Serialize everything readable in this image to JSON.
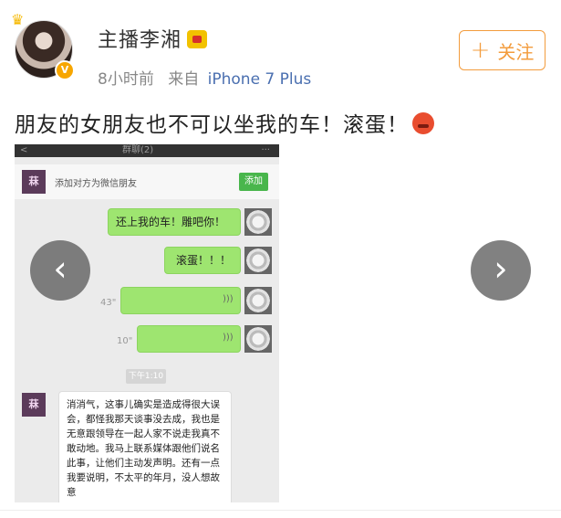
{
  "author": {
    "name": "主播李湘",
    "time": "8小时前",
    "source_prefix": "来自",
    "source": "iPhone 7 Plus"
  },
  "follow_button": {
    "label": "关注",
    "color": "#f39c3d"
  },
  "post": {
    "text": "朋友的女朋友也不可以坐我的车！滚蛋！"
  },
  "screenshot": {
    "back_label": "<",
    "chat_title": "群聊(2)",
    "menu_icon": "···",
    "add_bar_text": "添加对方为微信朋友",
    "add_button": "添加",
    "avatar_char": "菻",
    "messages_out": [
      {
        "text": "还上我的车！雕吧你！"
      },
      {
        "text": "滚蛋！！！"
      }
    ],
    "voice_messages": [
      {
        "duration": "43\""
      },
      {
        "duration": "10\""
      }
    ],
    "time_chip": "下午1:10",
    "incoming_text": "消消气，这事儿确实是造成得很大误会，都怪我那天谈事没去成，我也是无意跟领导在一起人家不说走我真不敢动地。我马上联系媒体跟他们说名此事，让他们主动发声明。还有一点我要说明，不太平的年月，没人想故意"
  },
  "icons": {
    "crown": "crown-icon",
    "verified": "verified-badge-icon",
    "emoji": "angry-face-icon",
    "prev": "chevron-left-icon",
    "next": "chevron-right-icon"
  }
}
